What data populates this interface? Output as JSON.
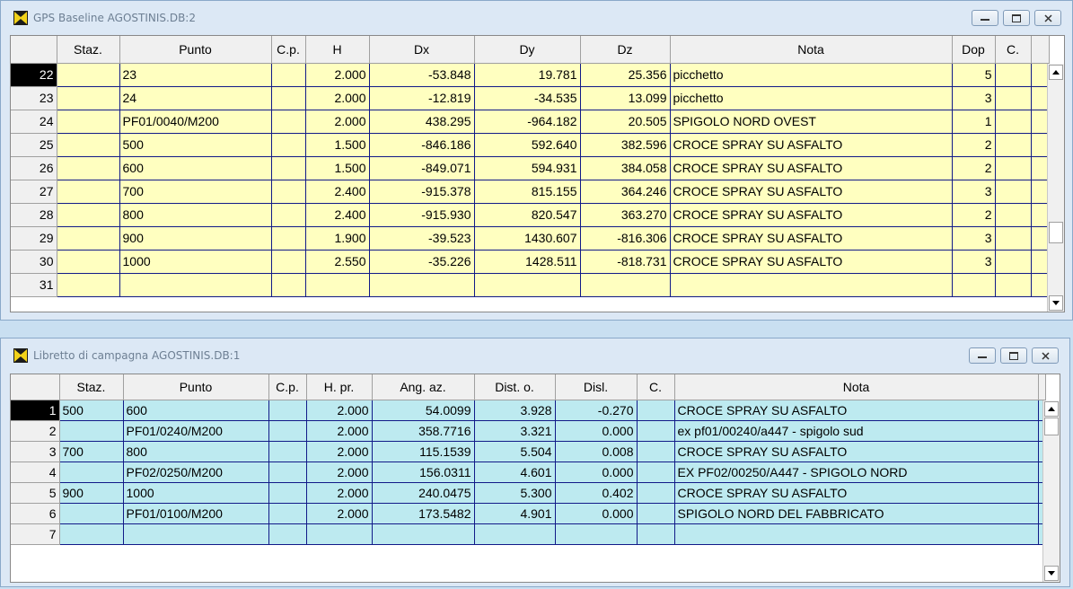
{
  "window1": {
    "title": "GPS Baseline AGOSTINIS.DB:2",
    "columns": [
      "",
      "Staz.",
      "Punto",
      "C.p.",
      "H",
      "Dx",
      "Dy",
      "Dz",
      "Nota",
      "Dop",
      "C."
    ],
    "rows": [
      {
        "n": "22",
        "staz": "",
        "punto": "23",
        "cp": "",
        "h": "2.000",
        "dx": "-53.848",
        "dy": "19.781",
        "dz": "25.356",
        "nota": "picchetto",
        "dop": "5",
        "c": ""
      },
      {
        "n": "23",
        "staz": "",
        "punto": "24",
        "cp": "",
        "h": "2.000",
        "dx": "-12.819",
        "dy": "-34.535",
        "dz": "13.099",
        "nota": "picchetto",
        "dop": "3",
        "c": ""
      },
      {
        "n": "24",
        "staz": "",
        "punto": "PF01/0040/M200",
        "cp": "",
        "h": "2.000",
        "dx": "438.295",
        "dy": "-964.182",
        "dz": "20.505",
        "nota": "SPIGOLO NORD OVEST",
        "dop": "1",
        "c": ""
      },
      {
        "n": "25",
        "staz": "",
        "punto": "500",
        "cp": "",
        "h": "1.500",
        "dx": "-846.186",
        "dy": "592.640",
        "dz": "382.596",
        "nota": "CROCE SPRAY SU ASFALTO",
        "dop": "2",
        "c": ""
      },
      {
        "n": "26",
        "staz": "",
        "punto": "600",
        "cp": "",
        "h": "1.500",
        "dx": "-849.071",
        "dy": "594.931",
        "dz": "384.058",
        "nota": "CROCE SPRAY SU ASFALTO",
        "dop": "2",
        "c": ""
      },
      {
        "n": "27",
        "staz": "",
        "punto": "700",
        "cp": "",
        "h": "2.400",
        "dx": "-915.378",
        "dy": "815.155",
        "dz": "364.246",
        "nota": "CROCE SPRAY SU ASFALTO",
        "dop": "3",
        "c": ""
      },
      {
        "n": "28",
        "staz": "",
        "punto": "800",
        "cp": "",
        "h": "2.400",
        "dx": "-915.930",
        "dy": "820.547",
        "dz": "363.270",
        "nota": "CROCE SPRAY SU ASFALTO",
        "dop": "2",
        "c": ""
      },
      {
        "n": "29",
        "staz": "",
        "punto": "900",
        "cp": "",
        "h": "1.900",
        "dx": "-39.523",
        "dy": "1430.607",
        "dz": "-816.306",
        "nota": "CROCE SPRAY SU ASFALTO",
        "dop": "3",
        "c": ""
      },
      {
        "n": "30",
        "staz": "",
        "punto": "1000",
        "cp": "",
        "h": "2.550",
        "dx": "-35.226",
        "dy": "1428.511",
        "dz": "-818.731",
        "nota": "CROCE SPRAY SU ASFALTO",
        "dop": "3",
        "c": ""
      },
      {
        "n": "31",
        "staz": "",
        "punto": "",
        "cp": "",
        "h": "",
        "dx": "",
        "dy": "",
        "dz": "",
        "nota": "",
        "dop": "",
        "c": ""
      }
    ]
  },
  "window2": {
    "title": "Libretto di campagna AGOSTINIS.DB:1",
    "columns": [
      "",
      "Staz.",
      "Punto",
      "C.p.",
      "H. pr.",
      "Ang. az.",
      "Dist. o.",
      "Disl.",
      "C.",
      "Nota"
    ],
    "rows": [
      {
        "n": "1",
        "staz": "500",
        "punto": "600",
        "cp": "",
        "hpr": "2.000",
        "ang": "54.0099",
        "dist": "3.928",
        "disl": "-0.270",
        "c": "",
        "nota": "CROCE SPRAY SU ASFALTO"
      },
      {
        "n": "2",
        "staz": "",
        "punto": "PF01/0240/M200",
        "cp": "",
        "hpr": "2.000",
        "ang": "358.7716",
        "dist": "3.321",
        "disl": "0.000",
        "c": "",
        "nota": "ex pf01/00240/a447 - spigolo sud"
      },
      {
        "n": "3",
        "staz": "700",
        "punto": "800",
        "cp": "",
        "hpr": "2.000",
        "ang": "115.1539",
        "dist": "5.504",
        "disl": "0.008",
        "c": "",
        "nota": "CROCE SPRAY SU ASFALTO"
      },
      {
        "n": "4",
        "staz": "",
        "punto": "PF02/0250/M200",
        "cp": "",
        "hpr": "2.000",
        "ang": "156.0311",
        "dist": "4.601",
        "disl": "0.000",
        "c": "",
        "nota": "EX PF02/00250/A447 - SPIGOLO NORD"
      },
      {
        "n": "5",
        "staz": "900",
        "punto": "1000",
        "cp": "",
        "hpr": "2.000",
        "ang": "240.0475",
        "dist": "5.300",
        "disl": "0.402",
        "c": "",
        "nota": "CROCE SPRAY SU ASFALTO"
      },
      {
        "n": "6",
        "staz": "",
        "punto": "PF01/0100/M200",
        "cp": "",
        "hpr": "2.000",
        "ang": "173.5482",
        "dist": "4.901",
        "disl": "0.000",
        "c": "",
        "nota": "SPIGOLO NORD DEL FABBRICATO"
      },
      {
        "n": "7",
        "staz": "",
        "punto": "",
        "cp": "",
        "hpr": "",
        "ang": "",
        "dist": "",
        "disl": "",
        "c": "",
        "nota": ""
      }
    ]
  },
  "colors": {
    "grid1_bg": "#ffffc0",
    "grid2_bg": "#bdeaf0",
    "gridline": "#111a88",
    "desktop": "#c9dff1"
  },
  "icons": {
    "app": "yellow-x-icon",
    "minimize": "minimize-icon",
    "maximize": "maximize-icon",
    "close": "close-icon"
  }
}
